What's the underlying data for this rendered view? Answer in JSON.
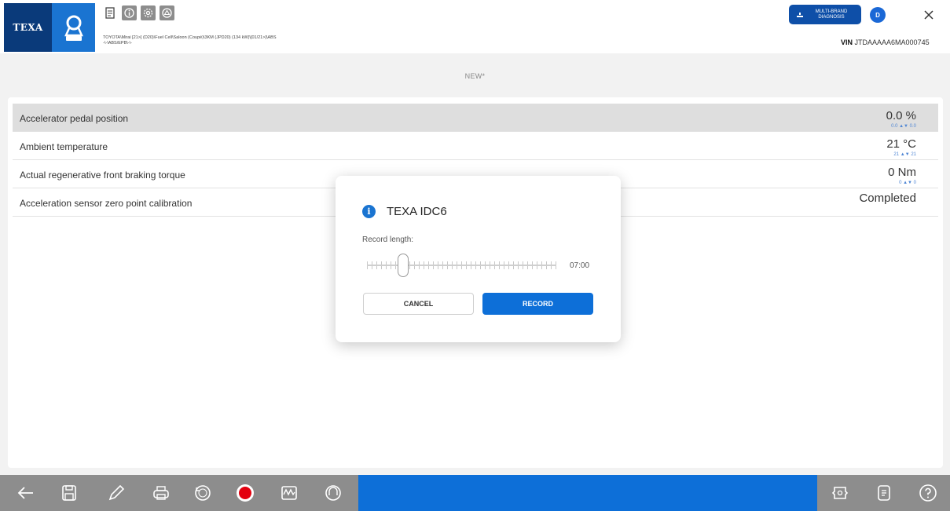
{
  "header": {
    "brand": "TEXA",
    "vehicle_path_line1": "TOYOTA\\Mirai [21>] (D20)\\Fuel Cell\\Saloon (Coupé)\\3KM (JPD20) (134 kW)\\[01/21>]\\ABS",
    "vehicle_path_line2": "-\\-\\ABS/EPB\\-\\-",
    "multi_brand_line1": "MULTI-BRAND",
    "multi_brand_line2": "DIAGNOSIS",
    "user_initial": "D",
    "vin_label": "VIN",
    "vin_value": "JTDAAAAA6MA000745",
    "icons": [
      "report-icon",
      "info-icon",
      "settings-icon",
      "cloud-icon",
      "close-icon"
    ]
  },
  "page": {
    "subtitle": "NEW*"
  },
  "parameters": [
    {
      "label": "Accelerator pedal position",
      "value": "0.0 %",
      "min": "0.0",
      "max": "0.0",
      "selected": true
    },
    {
      "label": "Ambient temperature",
      "value": "21 °C",
      "min": "21",
      "max": "21",
      "selected": false
    },
    {
      "label": "Actual regenerative front braking torque",
      "value": "0 Nm",
      "min": "0",
      "max": "0",
      "selected": false
    },
    {
      "label": "Acceleration sensor zero point calibration",
      "value": "Completed",
      "min": "",
      "max": "",
      "selected": false
    }
  ],
  "dialog": {
    "title": "TEXA IDC6",
    "record_length_label": "Record length:",
    "record_length_value": "07:00",
    "slider_fraction": 0.19,
    "cancel_label": "CANCEL",
    "record_label": "RECORD"
  },
  "toolbar": {
    "left_icons": [
      "back-icon",
      "save-icon",
      "edit-icon",
      "print-icon",
      "reset-minmax-icon",
      "record-icon",
      "graph-icon",
      "gauge-icon"
    ],
    "right_icons": [
      "ecu-icon",
      "document-icon",
      "help-icon"
    ]
  },
  "colors": {
    "accent": "#0d6fd8",
    "brand_dark": "#0a3a7a",
    "toolbar_gray": "#8d8d8d",
    "record_red": "#e3000f"
  }
}
